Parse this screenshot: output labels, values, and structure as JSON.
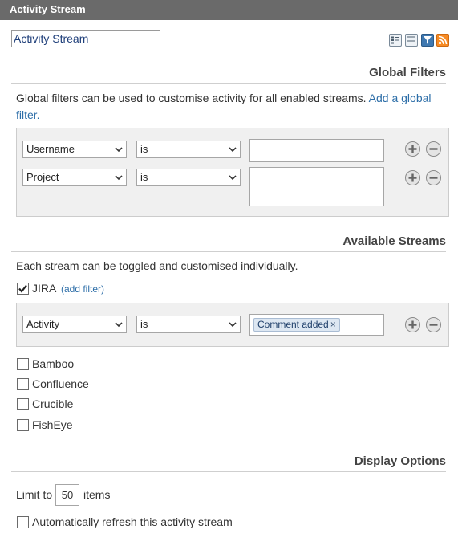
{
  "window": {
    "title": "Activity Stream"
  },
  "header": {
    "title_value": "Activity Stream",
    "icons": [
      "detailed-view-icon",
      "list-view-icon",
      "filter-icon",
      "rss-feed-icon"
    ],
    "accent": "#f78b24"
  },
  "global_filters": {
    "heading": "Global Filters",
    "description": "Global filters can be used to customise activity for all enabled streams.",
    "add_link": "Add a global filter.",
    "rows": [
      {
        "field": "Username",
        "operator": "is",
        "value": ""
      },
      {
        "field": "Project",
        "operator": "is",
        "value": ""
      }
    ]
  },
  "available_streams": {
    "heading": "Available Streams",
    "description": "Each stream can be toggled and customised individually.",
    "streams": [
      {
        "label": "JIRA",
        "checked": true,
        "add_filter": "(add filter)"
      },
      {
        "label": "Bamboo",
        "checked": false
      },
      {
        "label": "Confluence",
        "checked": false
      },
      {
        "label": "Crucible",
        "checked": false
      },
      {
        "label": "FishEye",
        "checked": false
      }
    ],
    "jira_filter": {
      "field": "Activity",
      "operator": "is",
      "tag": "Comment added",
      "tag_remove": "×"
    }
  },
  "display_options": {
    "heading": "Display Options",
    "limit_prefix": "Limit to",
    "limit_value": "50",
    "limit_suffix": "items",
    "auto_refresh_label": "Automatically refresh this activity stream",
    "auto_refresh_checked": false
  },
  "colors": {
    "titlebar": "#6a6a6a",
    "link": "#2d6ea8",
    "filter_bg": "#f0f0f0"
  }
}
